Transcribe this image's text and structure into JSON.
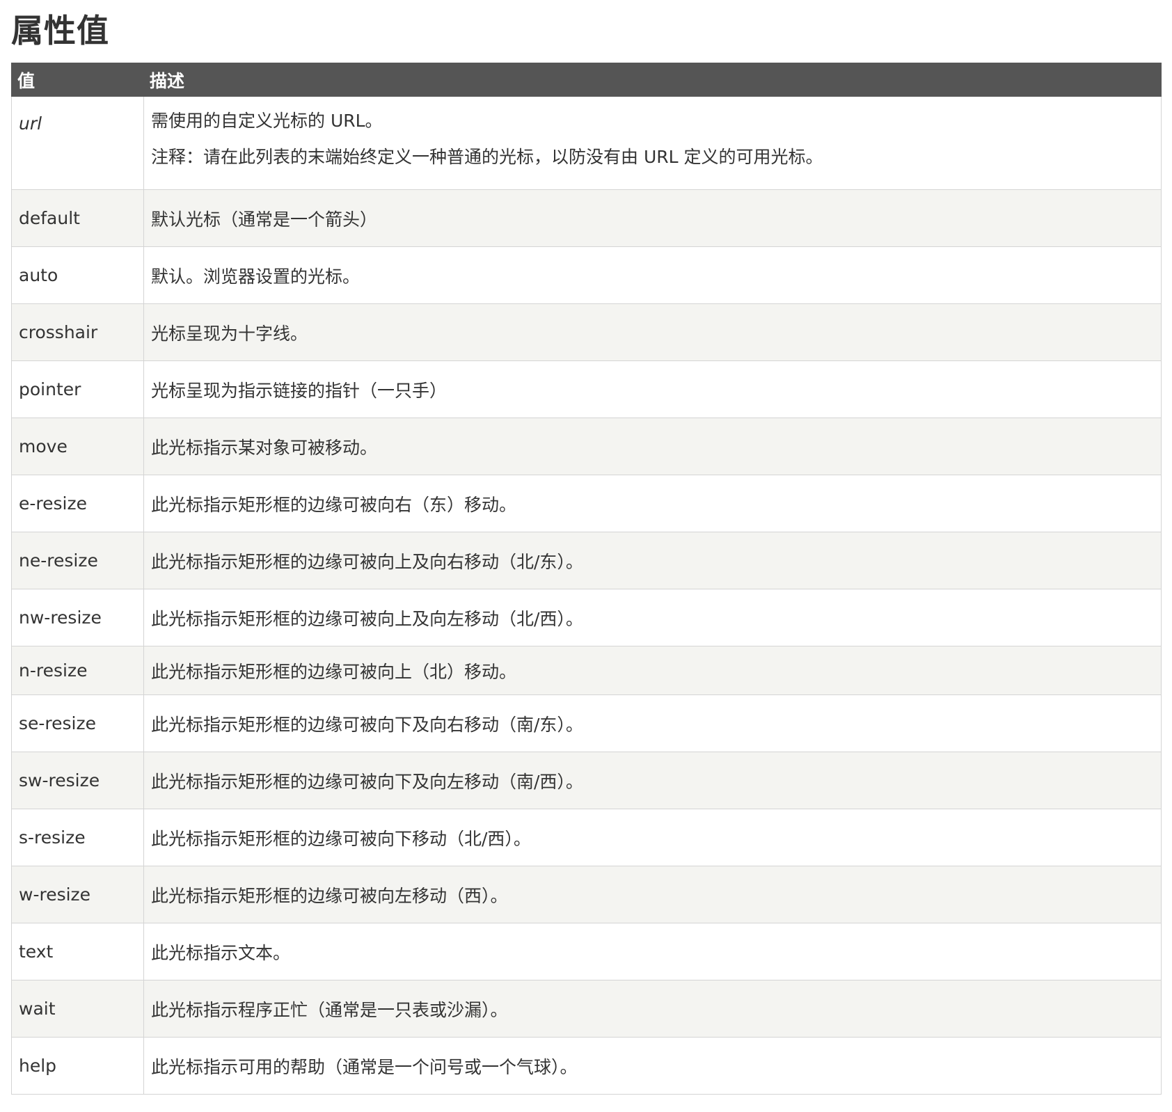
{
  "page": {
    "title": "属性值"
  },
  "table": {
    "headers": {
      "value": "值",
      "description": "描述"
    },
    "rows": [
      {
        "value": "url",
        "description": "需使用的自定义光标的 URL。",
        "note": "注释：请在此列表的末端始终定义一种普通的光标，以防没有由 URL 定义的可用光标。"
      },
      {
        "value": "default",
        "description": "默认光标（通常是一个箭头）"
      },
      {
        "value": "auto",
        "description": "默认。浏览器设置的光标。"
      },
      {
        "value": "crosshair",
        "description": "光标呈现为十字线。"
      },
      {
        "value": "pointer",
        "description": "光标呈现为指示链接的指针（一只手）"
      },
      {
        "value": "move",
        "description": "此光标指示某对象可被移动。"
      },
      {
        "value": "e-resize",
        "description": "此光标指示矩形框的边缘可被向右（东）移动。"
      },
      {
        "value": "ne-resize",
        "description": "此光标指示矩形框的边缘可被向上及向右移动（北/东）。"
      },
      {
        "value": "nw-resize",
        "description": "此光标指示矩形框的边缘可被向上及向左移动（北/西）。"
      },
      {
        "value": "n-resize",
        "description": "此光标指示矩形框的边缘可被向上（北）移动。"
      },
      {
        "value": "se-resize",
        "description": "此光标指示矩形框的边缘可被向下及向右移动（南/东）。"
      },
      {
        "value": "sw-resize",
        "description": "此光标指示矩形框的边缘可被向下及向左移动（南/西）。"
      },
      {
        "value": "s-resize",
        "description": "此光标指示矩形框的边缘可被向下移动（北/西）。"
      },
      {
        "value": "w-resize",
        "description": "此光标指示矩形框的边缘可被向左移动（西）。"
      },
      {
        "value": "text",
        "description": "此光标指示文本。"
      },
      {
        "value": "wait",
        "description": "此光标指示程序正忙（通常是一只表或沙漏）。"
      },
      {
        "value": "help",
        "description": "此光标指示可用的帮助（通常是一个问号或一个气球）。"
      }
    ]
  }
}
